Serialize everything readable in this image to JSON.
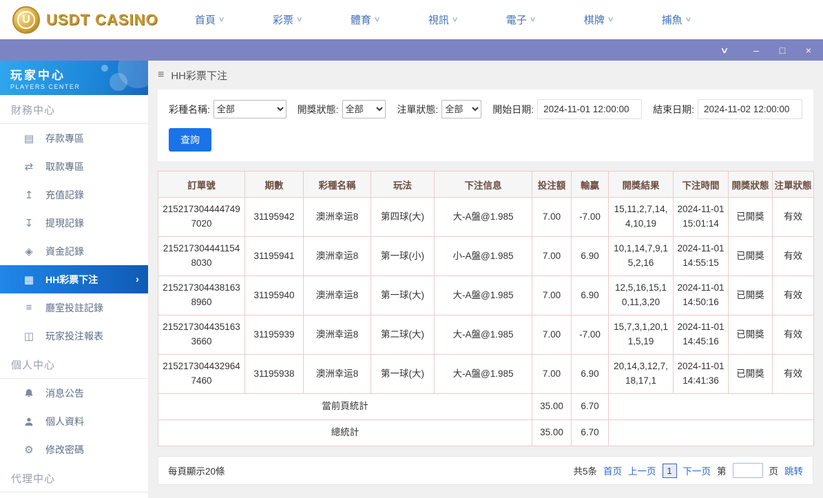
{
  "topnav": {
    "brand": "USDT CASINO",
    "brand_initial": "U",
    "items": [
      "首頁",
      "彩票",
      "體育",
      "視訊",
      "電子",
      "棋牌",
      "捕魚"
    ]
  },
  "icons": {
    "hamburger": "≡",
    "nav_chevron": "∨",
    "window_chevron": "∨",
    "window_minimize": "–",
    "window_maximize": "□",
    "window_close": "×",
    "active_chevron": "›",
    "deposit": "▤",
    "withdraw": "⇄",
    "recharge": "↥",
    "withdraw_record": "↧",
    "funds": "◈",
    "lottery_bet": "▦",
    "hall_record": "≡",
    "report": "◫",
    "gear": "⚙"
  },
  "sidebar": {
    "title": "玩家中心",
    "subtitle": "PLAYERS CENTER",
    "finance_label": "財務中心",
    "personal_label": "個人中心",
    "agent_label": "代理中心",
    "items_finance": [
      {
        "label": "存款專區"
      },
      {
        "label": "取款專區"
      },
      {
        "label": "充值記錄"
      },
      {
        "label": "提現記錄"
      },
      {
        "label": "資金記錄"
      },
      {
        "label": "HH彩票下注"
      },
      {
        "label": "廳室投註記錄"
      },
      {
        "label": "玩家投注報表"
      }
    ],
    "items_personal": [
      {
        "label": "消息公告"
      },
      {
        "label": "個人資料"
      },
      {
        "label": "修改密碼"
      }
    ]
  },
  "breadcrumb": {
    "title": "HH彩票下注"
  },
  "filters": {
    "lottery_label": "彩種名稱:",
    "lottery_value": "全部",
    "draw_label": "開獎狀態:",
    "draw_value": "全部",
    "order_label": "注單狀態:",
    "order_value": "全部",
    "start_label": "開始日期:",
    "start_value": "2024-11-01 12:00:00",
    "end_label": "結束日期:",
    "end_value": "2024-11-02 12:00:00",
    "search": "查詢"
  },
  "table": {
    "headers": [
      "訂單號",
      "期數",
      "彩種名稱",
      "玩法",
      "下注信息",
      "投注額",
      "輸贏",
      "開獎結果",
      "下注時間",
      "開獎狀態",
      "注單狀態"
    ],
    "rows": [
      {
        "order_id": "2152173044447497020",
        "period": "31195942",
        "lottery": "澳洲幸运8",
        "play": "第四球(大)",
        "bet_info": "大-A盤@1.985",
        "amount": "7.00",
        "win_loss": "-7.00",
        "result": "15,11,2,7,14,4,10,19",
        "bet_time": "2024-11-01 15:01:14",
        "draw_status": "已開獎",
        "order_status": "有效"
      },
      {
        "order_id": "2152173044411548030",
        "period": "31195941",
        "lottery": "澳洲幸运8",
        "play": "第一球(小)",
        "bet_info": "小-A盤@1.985",
        "amount": "7.00",
        "win_loss": "6.90",
        "result": "10,1,14,7,9,15,2,16",
        "bet_time": "2024-11-01 14:55:15",
        "draw_status": "已開獎",
        "order_status": "有效"
      },
      {
        "order_id": "2152173044381638960",
        "period": "31195940",
        "lottery": "澳洲幸运8",
        "play": "第一球(大)",
        "bet_info": "大-A盤@1.985",
        "amount": "7.00",
        "win_loss": "6.90",
        "result": "12,5,16,15,10,11,3,20",
        "bet_time": "2024-11-01 14:50:16",
        "draw_status": "已開獎",
        "order_status": "有效"
      },
      {
        "order_id": "2152173044351633660",
        "period": "31195939",
        "lottery": "澳洲幸运8",
        "play": "第二球(大)",
        "bet_info": "大-A盤@1.985",
        "amount": "7.00",
        "win_loss": "-7.00",
        "result": "15,7,3,1,20,11,5,19",
        "bet_time": "2024-11-01 14:45:16",
        "draw_status": "已開獎",
        "order_status": "有效"
      },
      {
        "order_id": "2152173044329647460",
        "period": "31195938",
        "lottery": "澳洲幸运8",
        "play": "第一球(大)",
        "bet_info": "大-A盤@1.985",
        "amount": "7.00",
        "win_loss": "6.90",
        "result": "20,14,3,12,7,18,17,1",
        "bet_time": "2024-11-01 14:41:36",
        "draw_status": "已開獎",
        "order_status": "有效"
      }
    ],
    "page_total": {
      "label": "當前頁統計",
      "amount": "35.00",
      "win_loss": "6.70"
    },
    "grand_total": {
      "label": "總統計",
      "amount": "35.00",
      "win_loss": "6.70"
    }
  },
  "pagination": {
    "per_page": "每頁顯示20條",
    "total": "共5条",
    "first": "首页",
    "prev": "上一页",
    "current": "1",
    "next": "下一页",
    "jump_pre": "第",
    "jump_post": "页",
    "jump": "跳转"
  }
}
